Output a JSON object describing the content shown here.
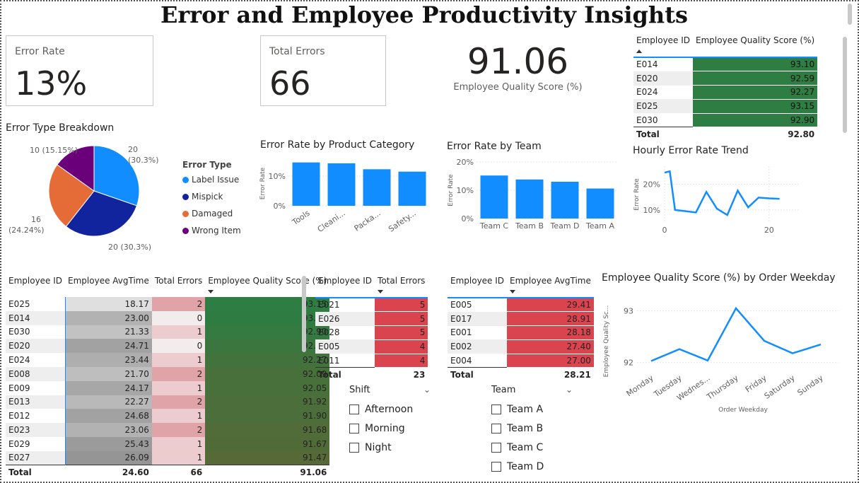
{
  "title": "Error and Employee Productivity Insights",
  "cards": {
    "error_rate": {
      "label": "Error Rate",
      "value": "13%"
    },
    "total_errors": {
      "label": "Total Errors",
      "value": "66"
    },
    "quality_score": {
      "label": "Employee Quality Score (%)",
      "value": "91.06"
    }
  },
  "top_quality_table": {
    "headers": [
      "Employee ID",
      "Employee Quality Score (%)"
    ],
    "rows": [
      {
        "id": "E014",
        "score": "93.10"
      },
      {
        "id": "E020",
        "score": "92.59"
      },
      {
        "id": "E024",
        "score": "92.27"
      },
      {
        "id": "E025",
        "score": "93.15"
      },
      {
        "id": "E030",
        "score": "92.90"
      }
    ],
    "total_label": "Total",
    "total_value": "92.80"
  },
  "pie": {
    "title": "Error Type Breakdown",
    "legend_title": "Error Type",
    "labels": [
      "20 (30.3%)",
      "20 (30.3%)",
      "16 (24.24%)",
      "10 (15.15%)"
    ],
    "legend": [
      "Label Issue",
      "Mispick",
      "Damaged",
      "Wrong Item"
    ],
    "colors": [
      "#118dff",
      "#12239e",
      "#e66c37",
      "#6b007b"
    ]
  },
  "chart_data": [
    {
      "type": "pie",
      "title": "Error Type Breakdown",
      "categories": [
        "Label Issue",
        "Mispick",
        "Damaged",
        "Wrong Item"
      ],
      "values": [
        20,
        20,
        16,
        10
      ],
      "percents": [
        30.3,
        30.3,
        24.24,
        15.15
      ],
      "legend": "right"
    },
    {
      "type": "bar",
      "title": "Error Rate by Product Category",
      "categories": [
        "Tools",
        "Cleani...",
        "Packa...",
        "Safety..."
      ],
      "values": [
        14.6,
        14.3,
        12.3,
        11.5
      ],
      "ylabel": "Error Rate",
      "yticks": [
        "0%",
        "10%"
      ],
      "ylim": [
        0,
        15
      ]
    },
    {
      "type": "bar",
      "title": "Error Rate by Team",
      "categories": [
        "Team C",
        "Team B",
        "Team D",
        "Team A"
      ],
      "values": [
        15.2,
        13.8,
        13.0,
        10.6
      ],
      "ylabel": "Error Rate",
      "yticks": [
        "0%",
        "10%",
        "20%"
      ],
      "ylim": [
        0,
        20
      ]
    },
    {
      "type": "line",
      "title": "Hourly Error Rate Trend",
      "x": [
        0,
        1,
        2,
        4,
        6,
        8,
        10,
        12,
        14,
        16,
        18,
        20,
        22
      ],
      "values": [
        24.5,
        25.0,
        10.0,
        9.5,
        9.0,
        17.0,
        10.5,
        8.0,
        17.5,
        11.0,
        14.8,
        14.5,
        14.3
      ],
      "ylabel": "Error Rate",
      "yticks": [
        "10%",
        "20%"
      ],
      "xticks": [
        "0",
        "20"
      ]
    },
    {
      "type": "line",
      "title": "Employee Quality Score (%) by Order Weekday",
      "categories": [
        "Monday",
        "Tuesday",
        "Wednes...",
        "Thursday",
        "Friday",
        "Saturday",
        "Sunday"
      ],
      "values": [
        92.03,
        92.26,
        92.04,
        93.05,
        92.42,
        92.18,
        92.35
      ],
      "xlabel": "Order Weekday",
      "ylabel": "Employee Quality Sc...",
      "yticks": [
        "92",
        "93"
      ],
      "ylim": [
        91.9,
        93.2
      ]
    }
  ],
  "main_table": {
    "headers": [
      "Employee ID",
      "Employee AvgTime",
      "Total Errors",
      "Employee Quality Score (%)"
    ],
    "rows": [
      {
        "id": "E025",
        "avg": "18.17",
        "err": "2",
        "score": "93.15"
      },
      {
        "id": "E014",
        "avg": "23.00",
        "err": "0",
        "score": "93.10"
      },
      {
        "id": "E030",
        "avg": "21.33",
        "err": "1",
        "score": "92.90"
      },
      {
        "id": "E020",
        "avg": "24.71",
        "err": "0",
        "score": "92.59"
      },
      {
        "id": "E024",
        "avg": "23.44",
        "err": "1",
        "score": "92.27"
      },
      {
        "id": "E008",
        "avg": "21.70",
        "err": "2",
        "score": "92.09"
      },
      {
        "id": "E009",
        "avg": "24.17",
        "err": "1",
        "score": "92.05"
      },
      {
        "id": "E013",
        "avg": "22.27",
        "err": "2",
        "score": "91.92"
      },
      {
        "id": "E012",
        "avg": "24.68",
        "err": "1",
        "score": "91.90"
      },
      {
        "id": "E023",
        "avg": "23.06",
        "err": "2",
        "score": "91.68"
      },
      {
        "id": "E029",
        "avg": "25.43",
        "err": "1",
        "score": "91.67"
      },
      {
        "id": "E027",
        "avg": "26.09",
        "err": "1",
        "score": "91.47"
      }
    ],
    "total_label": "Total",
    "total_avg": "24.60",
    "total_err": "66",
    "total_score": "91.06"
  },
  "errors_table": {
    "headers": [
      "Employee ID",
      "Total Errors"
    ],
    "rows": [
      {
        "id": "E021",
        "val": "5"
      },
      {
        "id": "E026",
        "val": "5"
      },
      {
        "id": "E028",
        "val": "5"
      },
      {
        "id": "E005",
        "val": "4"
      },
      {
        "id": "E011",
        "val": "4"
      }
    ],
    "total_label": "Total",
    "total_value": "23"
  },
  "avgtime_table": {
    "headers": [
      "Employee ID",
      "Employee AvgTime"
    ],
    "rows": [
      {
        "id": "E005",
        "val": "29.41"
      },
      {
        "id": "E017",
        "val": "28.91"
      },
      {
        "id": "E001",
        "val": "28.18"
      },
      {
        "id": "E002",
        "val": "27.40"
      },
      {
        "id": "E004",
        "val": "27.00"
      }
    ],
    "total_label": "Total",
    "total_value": "28.21"
  },
  "shift_slicer": {
    "title": "Shift",
    "options": [
      "Afternoon",
      "Morning",
      "Night"
    ]
  },
  "team_slicer": {
    "title": "Team",
    "options": [
      "Team A",
      "Team B",
      "Team C",
      "Team D"
    ]
  },
  "colors": {
    "bar": "#118dff",
    "green": "#2e7d43",
    "red": "#d9444f",
    "line": "#118dff"
  }
}
